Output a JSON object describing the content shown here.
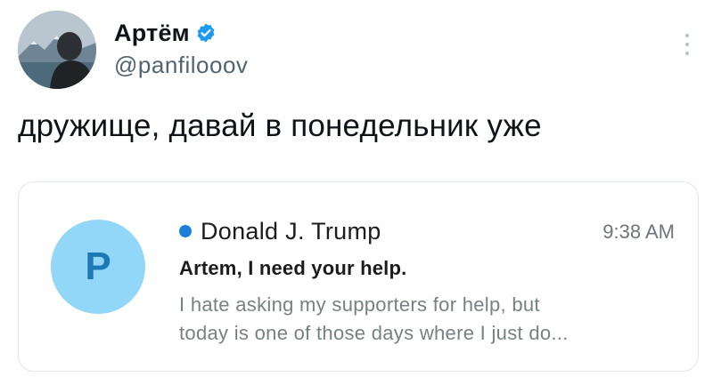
{
  "author": {
    "display_name": "Артём",
    "handle": "@panfilooov",
    "verified_icon": "verified-badge-icon",
    "accent_color": "#1d9bf0"
  },
  "tweet": {
    "text": "дружище, давай в понедельник уже"
  },
  "email_card": {
    "avatar_letter": "P",
    "sender": "Donald J. Trump",
    "time": "9:38 AM",
    "subject": "Artem, I need your help.",
    "preview_line1": "I hate asking my supporters for help, but",
    "preview_line2": "today is one of those days where I just do...",
    "unread_color": "#1c7fd9",
    "avatar_color": "#92d7f7"
  }
}
